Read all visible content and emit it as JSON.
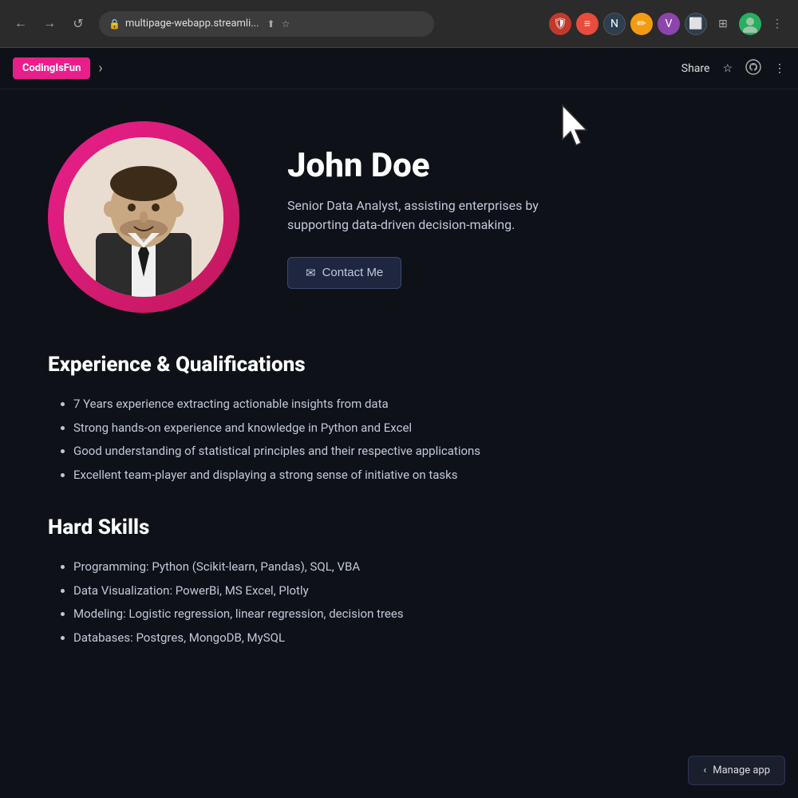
{
  "browser": {
    "url": "multipage-webapp.streamli...",
    "nav": {
      "back": "←",
      "forward": "→",
      "reload": "↺"
    }
  },
  "appbar": {
    "logo_label": "CodingIsFun",
    "chevron": "›",
    "share_label": "Share",
    "bookmark_icon": "☆",
    "github_icon": "⊙",
    "more_icon": "⋮"
  },
  "profile": {
    "name": "John Doe",
    "title": "Senior Data Analyst, assisting enterprises by supporting data-driven decision-making.",
    "contact_btn_label": "Contact Me",
    "contact_btn_icon": "✉"
  },
  "experience": {
    "section_title": "Experience & Qualifications",
    "items": [
      "7 Years experience extracting actionable insights from data",
      "Strong hands-on experience and knowledge in Python and Excel",
      "Good understanding of statistical principles and their respective applications",
      "Excellent team-player and displaying a strong sense of initiative on tasks"
    ]
  },
  "hard_skills": {
    "section_title": "Hard Skills",
    "items": [
      "Programming: Python (Scikit-learn, Pandas), SQL, VBA",
      "Data Visualization: PowerBi, MS Excel, Plotly",
      "Modeling: Logistic regression, linear regression, decision trees",
      "Databases: Postgres, MongoDB, MySQL"
    ]
  },
  "manage_app": {
    "chevron": "‹",
    "label": "Manage app"
  }
}
